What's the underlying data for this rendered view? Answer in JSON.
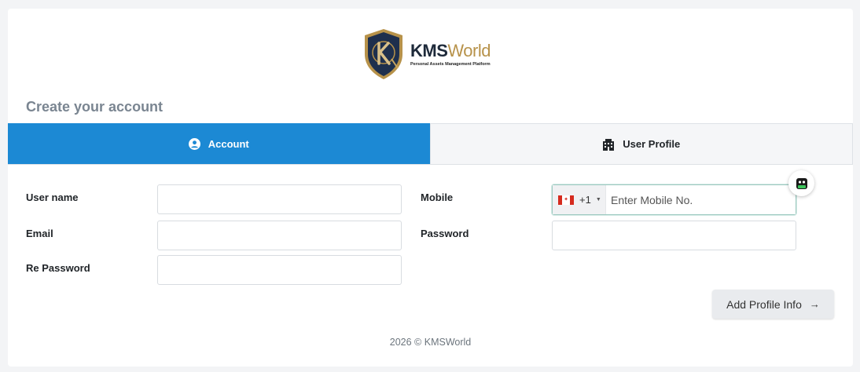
{
  "brand": {
    "name_part1": "KMS",
    "name_part2": "World",
    "tagline": "Personal Assets Management Platform",
    "accent_color": "#b7924a"
  },
  "page": {
    "title": "Create your account"
  },
  "tabs": [
    {
      "label": "Account",
      "icon": "user-circle-icon",
      "active": true
    },
    {
      "label": "User Profile",
      "icon": "building-icon",
      "active": false
    }
  ],
  "form": {
    "username": {
      "label": "User name",
      "value": ""
    },
    "email": {
      "label": "Email",
      "value": ""
    },
    "repassword": {
      "label": "Re Password",
      "value": ""
    },
    "mobile": {
      "label": "Mobile",
      "country_code": "+1",
      "country_flag": "canada-flag-icon",
      "placeholder": "Enter Mobile No.",
      "value": ""
    },
    "password": {
      "label": "Password",
      "value": ""
    }
  },
  "actions": {
    "next_label": "Add Profile Info",
    "next_icon": "arrow-right-icon"
  },
  "footer": {
    "text": "2026 © KMSWorld"
  },
  "colors": {
    "primary": "#1c89d4",
    "title_gray": "#7a8591"
  }
}
